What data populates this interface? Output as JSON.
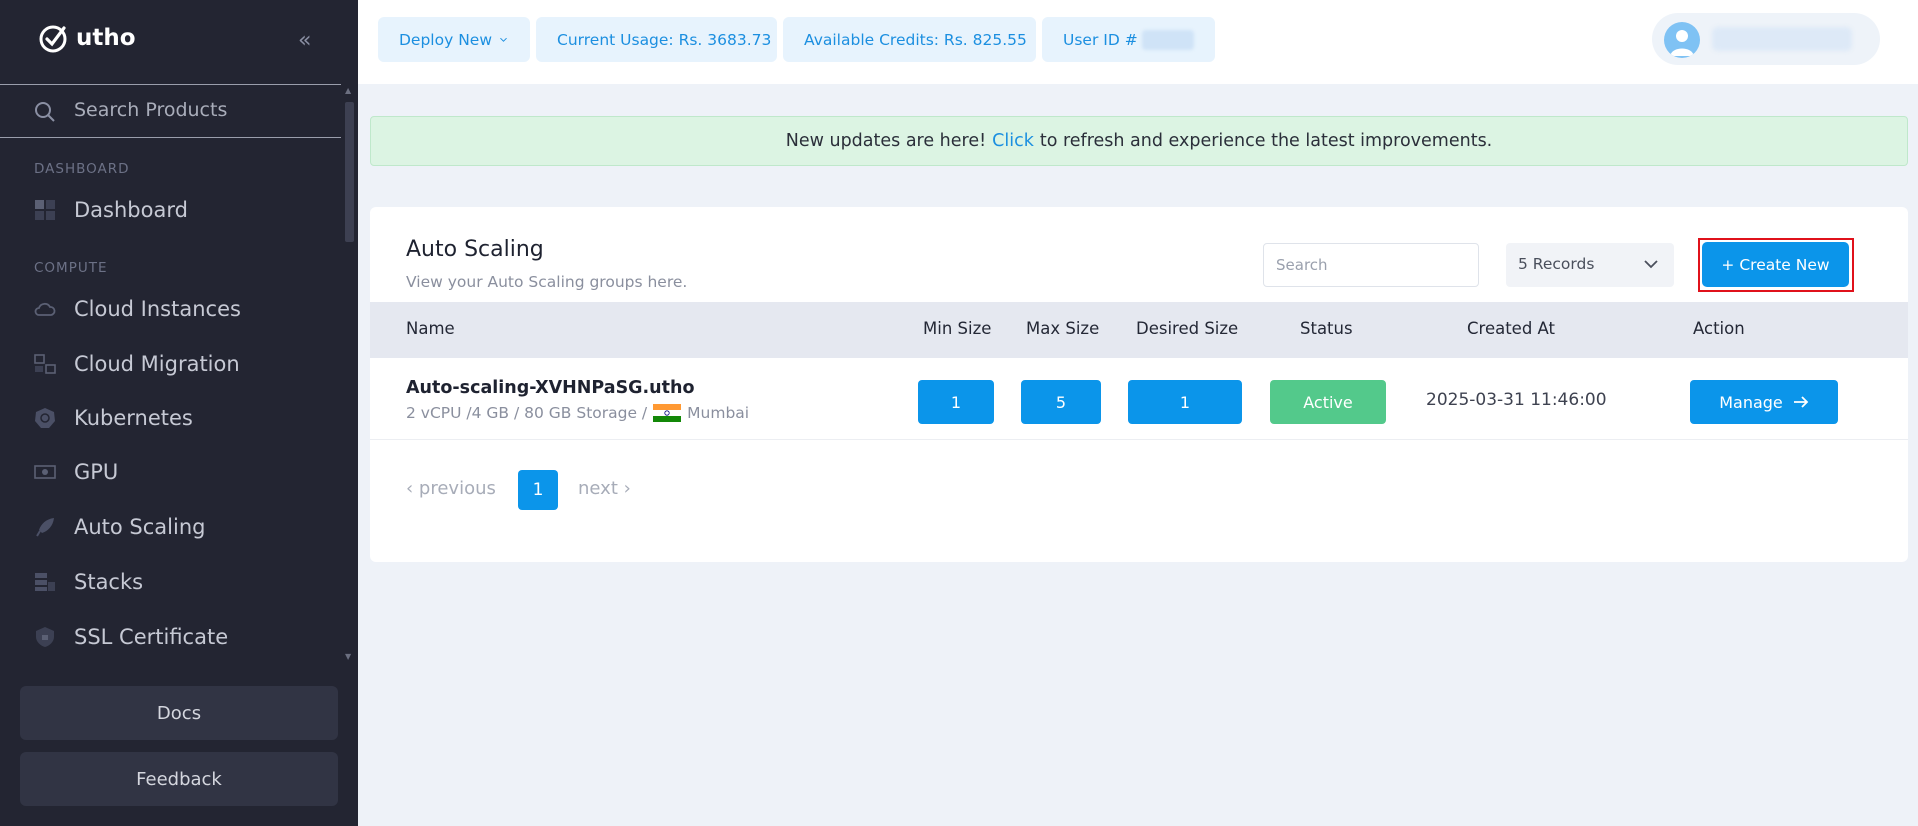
{
  "app": {
    "name": "utho"
  },
  "sidebar": {
    "search_placeholder": "Search Products",
    "sections": {
      "dashboard": "DASHBOARD",
      "compute": "COMPUTE"
    },
    "items": [
      {
        "label": "Dashboard",
        "icon": "grid-icon"
      },
      {
        "label": "Cloud Instances",
        "icon": "cloud-icon"
      },
      {
        "label": "Cloud Migration",
        "icon": "migration-icon"
      },
      {
        "label": "Kubernetes",
        "icon": "kubernetes-icon"
      },
      {
        "label": "GPU",
        "icon": "gpu-icon"
      },
      {
        "label": "Auto Scaling",
        "icon": "rocket-icon"
      },
      {
        "label": "Stacks",
        "icon": "stacks-icon"
      },
      {
        "label": "SSL Certificate",
        "icon": "shield-icon"
      }
    ],
    "docs_label": "Docs",
    "feedback_label": "Feedback"
  },
  "topbar": {
    "deploy_label": "Deploy New",
    "usage_label": "Current Usage: Rs. 3683.73",
    "credits_label": "Available Credits: Rs. 825.55",
    "userid_label": "User ID #"
  },
  "banner": {
    "before": "New updates are here!",
    "link": "Click",
    "after": "to refresh and experience the latest improvements."
  },
  "card": {
    "title": "Auto Scaling",
    "subtitle": "View your Auto Scaling groups here.",
    "search_placeholder": "Search",
    "records_label": "5 Records",
    "create_label": "+ Create New"
  },
  "table": {
    "headers": {
      "name": "Name",
      "min": "Min Size",
      "max": "Max Size",
      "desired": "Desired Size",
      "status": "Status",
      "created": "Created At",
      "action": "Action"
    },
    "rows": [
      {
        "name": "Auto-scaling-XVHNPaSG.utho",
        "spec": "2 vCPU /4 GB / 80 GB Storage /",
        "location": "Mumbai",
        "min": "1",
        "max": "5",
        "desired": "1",
        "status": "Active",
        "created": "2025-03-31 11:46:00",
        "action": "Manage"
      }
    ]
  },
  "pagination": {
    "previous": "‹ previous",
    "current": "1",
    "next": "next ›"
  },
  "colors": {
    "sidebar_bg": "#232532",
    "primary": "#0b95ea",
    "active": "#53c98b",
    "highlight": "#e0111b"
  }
}
